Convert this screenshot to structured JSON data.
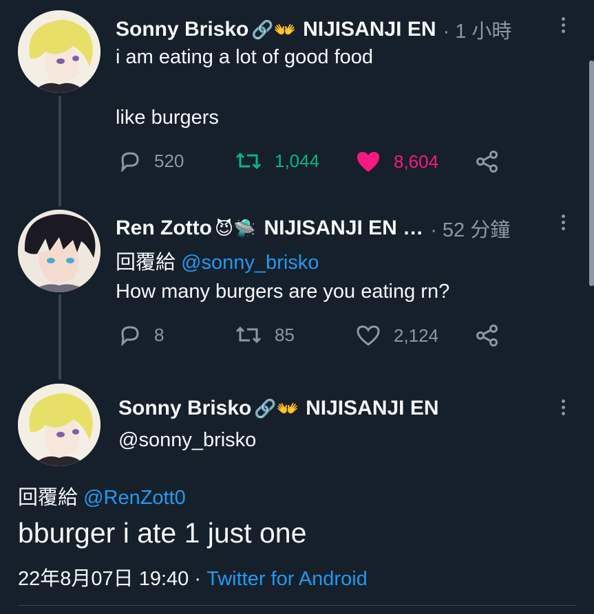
{
  "colors": {
    "background": "#15202b",
    "muted": "#8b98a5",
    "link": "#1d9bf0",
    "retweet": "#00ba7c",
    "like": "#f91880"
  },
  "tweet1": {
    "author": "Sonny Brisko",
    "emojis": "🔗👐",
    "affiliation": "NIJISANJI EN",
    "time": "· 1 小時",
    "line1": "i am eating a lot of good food",
    "line2": "like burgers",
    "replies": "520",
    "retweets": "1,044",
    "likes": "8,604",
    "liked": true,
    "retweeted": true
  },
  "tweet2": {
    "author": "Ren Zotto",
    "emojis": "😈🛸",
    "affiliation": "NIJISANJI EN …",
    "time": "· 52 分鐘",
    "reply_prefix": "回覆給",
    "reply_to": "@sonny_brisko",
    "text": "How many burgers are you eating rn?",
    "replies": "8",
    "retweets": "85",
    "likes": "2,124"
  },
  "tweet3": {
    "author": "Sonny Brisko",
    "emojis": "🔗👐",
    "affiliation": "NIJISANJI EN",
    "handle": "@sonny_brisko",
    "reply_prefix": "回覆給",
    "reply_to": "@RenZott0",
    "text": "bburger i ate 1 just one",
    "datetime": "22年8月07日 19:40",
    "separator": "·",
    "source": "Twitter for Android"
  },
  "icons": [
    "reply-icon",
    "retweet-icon",
    "like-icon",
    "share-icon",
    "more-icon"
  ]
}
